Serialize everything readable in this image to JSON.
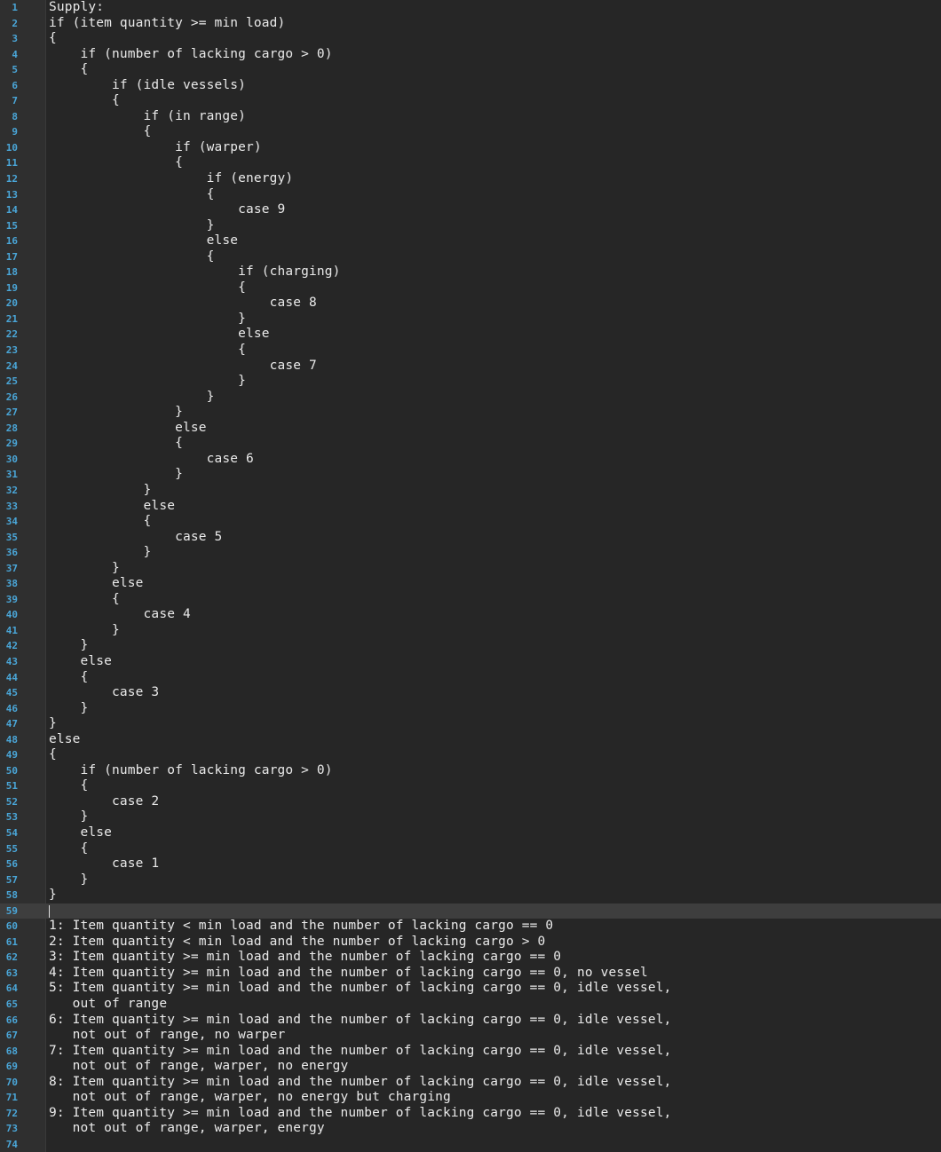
{
  "editor": {
    "current_line": 59,
    "lines": [
      {
        "n": "1",
        "text": "Supply:"
      },
      {
        "n": "2",
        "text": "if (item quantity >= min load)"
      },
      {
        "n": "3",
        "text": "{"
      },
      {
        "n": "4",
        "text": "    if (number of lacking cargo > 0)"
      },
      {
        "n": "5",
        "text": "    {"
      },
      {
        "n": "6",
        "text": "        if (idle vessels)"
      },
      {
        "n": "7",
        "text": "        {"
      },
      {
        "n": "8",
        "text": "            if (in range)"
      },
      {
        "n": "9",
        "text": "            {"
      },
      {
        "n": "10",
        "text": "                if (warper)"
      },
      {
        "n": "11",
        "text": "                {"
      },
      {
        "n": "12",
        "text": "                    if (energy)"
      },
      {
        "n": "13",
        "text": "                    {"
      },
      {
        "n": "14",
        "text": "                        case 9"
      },
      {
        "n": "15",
        "text": "                    }"
      },
      {
        "n": "16",
        "text": "                    else"
      },
      {
        "n": "17",
        "text": "                    {"
      },
      {
        "n": "18",
        "text": "                        if (charging)"
      },
      {
        "n": "19",
        "text": "                        {"
      },
      {
        "n": "20",
        "text": "                            case 8"
      },
      {
        "n": "21",
        "text": "                        }"
      },
      {
        "n": "22",
        "text": "                        else"
      },
      {
        "n": "23",
        "text": "                        {"
      },
      {
        "n": "24",
        "text": "                            case 7"
      },
      {
        "n": "25",
        "text": "                        }"
      },
      {
        "n": "26",
        "text": "                    }"
      },
      {
        "n": "27",
        "text": "                }"
      },
      {
        "n": "28",
        "text": "                else"
      },
      {
        "n": "29",
        "text": "                {"
      },
      {
        "n": "30",
        "text": "                    case 6"
      },
      {
        "n": "31",
        "text": "                }"
      },
      {
        "n": "32",
        "text": "            }"
      },
      {
        "n": "33",
        "text": "            else"
      },
      {
        "n": "34",
        "text": "            {"
      },
      {
        "n": "35",
        "text": "                case 5"
      },
      {
        "n": "36",
        "text": "            }"
      },
      {
        "n": "37",
        "text": "        }"
      },
      {
        "n": "38",
        "text": "        else"
      },
      {
        "n": "39",
        "text": "        {"
      },
      {
        "n": "40",
        "text": "            case 4"
      },
      {
        "n": "41",
        "text": "        }"
      },
      {
        "n": "42",
        "text": "    }"
      },
      {
        "n": "43",
        "text": "    else"
      },
      {
        "n": "44",
        "text": "    {"
      },
      {
        "n": "45",
        "text": "        case 3"
      },
      {
        "n": "46",
        "text": "    }"
      },
      {
        "n": "47",
        "text": "}"
      },
      {
        "n": "48",
        "text": "else"
      },
      {
        "n": "49",
        "text": "{"
      },
      {
        "n": "50",
        "text": "    if (number of lacking cargo > 0)"
      },
      {
        "n": "51",
        "text": "    {"
      },
      {
        "n": "52",
        "text": "        case 2"
      },
      {
        "n": "53",
        "text": "    }"
      },
      {
        "n": "54",
        "text": "    else"
      },
      {
        "n": "55",
        "text": "    {"
      },
      {
        "n": "56",
        "text": "        case 1"
      },
      {
        "n": "57",
        "text": "    }"
      },
      {
        "n": "58",
        "text": "}"
      },
      {
        "n": "59",
        "text": ""
      },
      {
        "n": "60",
        "text": "1: Item quantity < min load and the number of lacking cargo == 0"
      },
      {
        "n": "61",
        "text": "2: Item quantity < min load and the number of lacking cargo > 0"
      },
      {
        "n": "62",
        "text": "3: Item quantity >= min load and the number of lacking cargo == 0"
      },
      {
        "n": "63",
        "text": "4: Item quantity >= min load and the number of lacking cargo == 0, no vessel"
      },
      {
        "n": "64",
        "text": "5: Item quantity >= min load and the number of lacking cargo == 0, idle vessel,"
      },
      {
        "n": "65",
        "text": "   out of range"
      },
      {
        "n": "66",
        "text": "6: Item quantity >= min load and the number of lacking cargo == 0, idle vessel,"
      },
      {
        "n": "67",
        "text": "   not out of range, no warper"
      },
      {
        "n": "68",
        "text": "7: Item quantity >= min load and the number of lacking cargo == 0, idle vessel,"
      },
      {
        "n": "69",
        "text": "   not out of range, warper, no energy"
      },
      {
        "n": "70",
        "text": "8: Item quantity >= min load and the number of lacking cargo == 0, idle vessel,"
      },
      {
        "n": "71",
        "text": "   not out of range, warper, no energy but charging"
      },
      {
        "n": "72",
        "text": "9: Item quantity >= min load and the number of lacking cargo == 0, idle vessel,"
      },
      {
        "n": "73",
        "text": "   not out of range, warper, energy"
      },
      {
        "n": "74",
        "text": ""
      }
    ]
  },
  "colors": {
    "background": "#262626",
    "gutter": "#2f2f2f",
    "line_number": "#4aa6d8",
    "text": "#eaeaea",
    "current_line": "#3e3e3e"
  }
}
